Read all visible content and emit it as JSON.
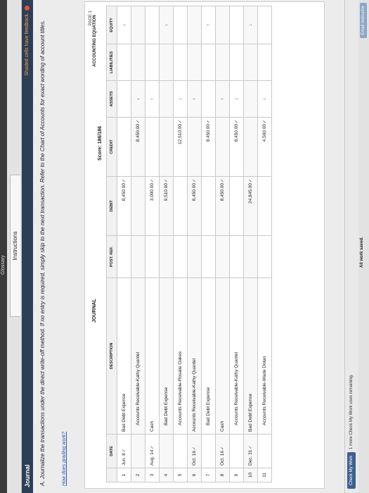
{
  "topbar_label": "Glossary",
  "tab_instructions": "Instructions",
  "window_title": "Journal",
  "feedback_text": "Shaded cells have feedback.",
  "instruction": "A. Journalize the transactions under the direct write-off method. If no entry is required, simply skip to the next transaction. Refer to the Chart of Accounts for exact wording of account titles.",
  "help_link": "How does grading work?",
  "page_label": "PAGE 1",
  "journal_title": "JOURNAL",
  "score": "Score: 186/186",
  "acct_eq_label": "ACCOUNTING EQUATION",
  "headers": {
    "date": "DATE",
    "description": "DESCRIPTION",
    "post_ref": "POST. REF.",
    "debit": "DEBIT",
    "credit": "CREDIT",
    "assets": "ASSETS",
    "liabilities": "LIABILITIES",
    "equity": "EQUITY"
  },
  "rows": [
    {
      "num": "1",
      "date": "Jun. 8",
      "desc": "Bad Debt Expense",
      "debit": "8,450.00",
      "credit": "",
      "assets": "",
      "liabilities": "",
      "equity": "↓"
    },
    {
      "num": "2",
      "date": "",
      "desc": "Accounts Receivable-Kathy Quantel",
      "debit": "",
      "credit": "8,450.00",
      "assets": "↓",
      "liabilities": "",
      "equity": ""
    },
    {
      "num": "3",
      "date": "Aug. 14",
      "desc": "Cash",
      "debit": "3,000.00",
      "credit": "",
      "assets": "↑",
      "liabilities": "",
      "equity": ""
    },
    {
      "num": "4",
      "date": "",
      "desc": "Bad Debt Expense",
      "debit": "9,510.00",
      "credit": "",
      "assets": "",
      "liabilities": "",
      "equity": "↓"
    },
    {
      "num": "5",
      "date": "",
      "desc": "Accounts Receivable-Rosalie Oakes",
      "debit": "",
      "credit": "12,510.00",
      "assets": "↓",
      "liabilities": "",
      "equity": ""
    },
    {
      "num": "6",
      "date": "Oct. 16",
      "desc": "Accounts Receivable-Kathy Quantel",
      "debit": "8,450.00",
      "credit": "",
      "assets": "↑",
      "liabilities": "",
      "equity": ""
    },
    {
      "num": "7",
      "date": "",
      "desc": "Bad Debt Expense",
      "debit": "",
      "credit": "8,450.00",
      "assets": "",
      "liabilities": "",
      "equity": "↑"
    },
    {
      "num": "8",
      "date": "Oct. 16",
      "desc": "Cash",
      "debit": "8,450.00",
      "credit": "",
      "assets": "↑",
      "liabilities": "",
      "equity": ""
    },
    {
      "num": "9",
      "date": "",
      "desc": "Accounts Receivable-Kathy Quantel",
      "debit": "",
      "credit": "8,450.00",
      "assets": "↓",
      "liabilities": "",
      "equity": ""
    },
    {
      "num": "10",
      "date": "Dec. 31",
      "desc": "Bad Debt Expense",
      "debit": "24,845.00",
      "credit": "",
      "assets": "",
      "liabilities": "",
      "equity": "↓"
    },
    {
      "num": "11",
      "date": "",
      "desc": "Accounts Receivable-Wade Dolan",
      "debit": "",
      "credit": "4,560.00",
      "assets": "↓",
      "liabilities": "",
      "equity": ""
    }
  ],
  "check_button": "Check My Work",
  "remaining_text": "1 more Check My Work uses remaining.",
  "saved_text": "All work saved.",
  "email_button": "Email Instructor",
  "colors": {
    "header": "#2d3f57",
    "feedback": "#f7a24a",
    "check": "#3a9b3a"
  }
}
